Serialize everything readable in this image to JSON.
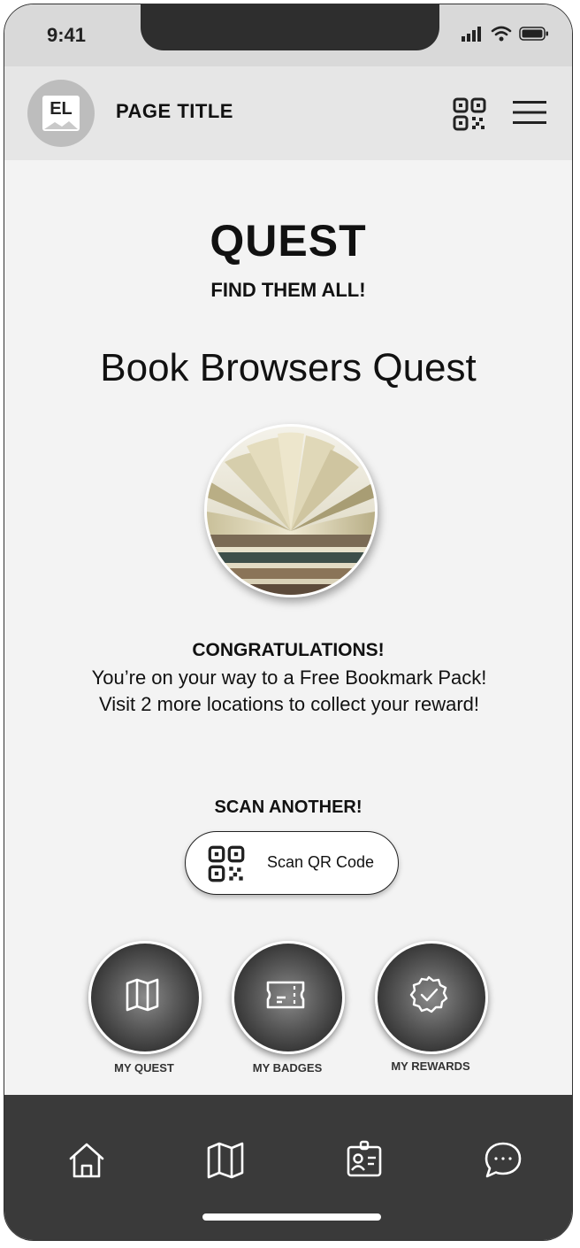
{
  "status_bar": {
    "time": "9:41"
  },
  "header": {
    "logo_text": "EL",
    "title": "PAGE TITLE"
  },
  "main": {
    "title": "QUEST",
    "subtitle": "FIND THEM ALL!",
    "quest_name": "Book Browsers Quest",
    "congrats_heading": "CONGRATULATIONS!",
    "message": "You’re on your way to a Free Bookmark Pack! Visit 2 more locations to collect your reward!",
    "scan_heading": "SCAN ANOTHER!",
    "scan_button_label": "Scan QR Code"
  },
  "quick_actions": [
    {
      "label": "MY QUEST",
      "icon": "map-icon"
    },
    {
      "label": "MY BADGES",
      "icon": "ticket-icon"
    },
    {
      "label": "MY REWARDS",
      "icon": "award-check-icon"
    }
  ],
  "bottom_nav": [
    {
      "icon": "home-icon"
    },
    {
      "icon": "map-icon"
    },
    {
      "icon": "id-badge-icon"
    },
    {
      "icon": "chat-bubble-icon"
    }
  ],
  "colors": {
    "background": "#f3f3f3",
    "header_bg": "#e6e6e6",
    "status_bg": "#d9d9d9",
    "nav_bg": "#3a3a3a",
    "accent_dark": "#2e2e2e"
  }
}
